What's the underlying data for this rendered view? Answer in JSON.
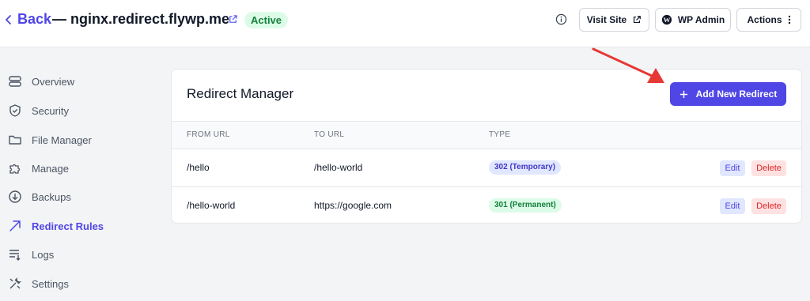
{
  "header": {
    "back_label": "Back",
    "site_title": "— nginx.redirect.flywp.me",
    "status_badge": "Active",
    "visit_site_label": "Visit Site",
    "wp_admin_label": "WP Admin",
    "actions_label": "Actions"
  },
  "sidebar": {
    "items": [
      {
        "label": "Overview",
        "icon": "disk-stack-icon"
      },
      {
        "label": "Security",
        "icon": "shield-check-icon"
      },
      {
        "label": "File Manager",
        "icon": "folder-icon"
      },
      {
        "label": "Manage",
        "icon": "puzzle-icon"
      },
      {
        "label": "Backups",
        "icon": "download-circle-icon"
      },
      {
        "label": "Redirect Rules",
        "icon": "arrow-up-right-icon",
        "active": true
      },
      {
        "label": "Logs",
        "icon": "list-icon"
      },
      {
        "label": "Settings",
        "icon": "tools-icon"
      }
    ]
  },
  "main": {
    "title": "Redirect Manager",
    "add_button_label": "Add New Redirect",
    "columns": [
      "FROM URL",
      "TO URL",
      "TYPE"
    ],
    "rows": [
      {
        "from": "/hello",
        "to": "/hello-world",
        "type": "302 (Temporary)",
        "type_color": "#4338ca",
        "type_bg": "#e0e7ff",
        "edit_label": "Edit",
        "delete_label": "Delete"
      },
      {
        "from": "/hello-world",
        "to": "https://google.com",
        "type": "301 (Permanent)",
        "type_color": "#15803d",
        "type_bg": "#dcfce7",
        "edit_label": "Edit",
        "delete_label": "Delete"
      }
    ]
  },
  "colors": {
    "accent": "#4f46e5",
    "annotation_arrow": "#e53935"
  }
}
